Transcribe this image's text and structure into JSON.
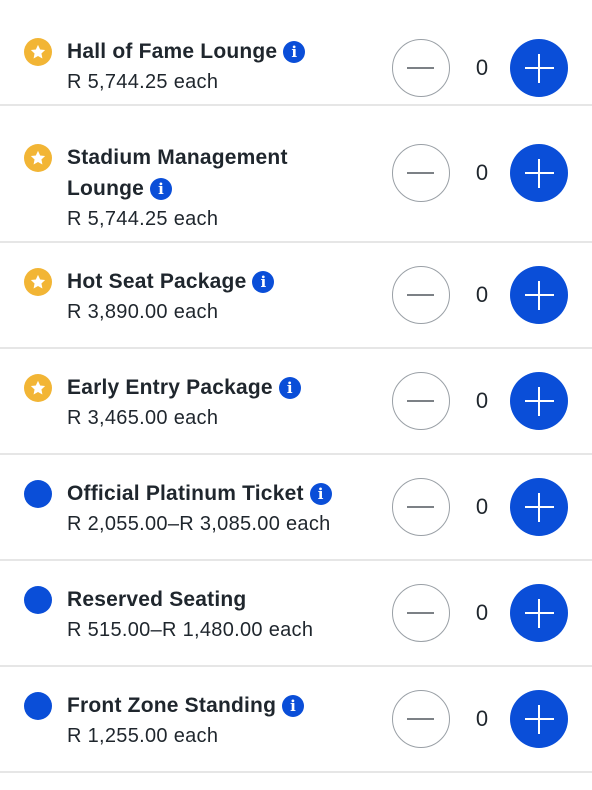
{
  "colors": {
    "accent": "#0a4ed8",
    "premium_marker": "#f2b535",
    "standard_marker": "#0a4ed8",
    "text": "#1f262d",
    "divider": "#e6e6e6"
  },
  "icons": {
    "info": "i",
    "premium_marker": "star-icon",
    "standard_marker": "dot-icon",
    "decrement": "minus-icon",
    "increment": "plus-icon"
  },
  "tickets": [
    {
      "name": "Hall of Fame Lounge",
      "name_line2": "",
      "price": "R 5,744.25 each",
      "quantity": "0",
      "tier": "premium"
    },
    {
      "name": "Stadium Management",
      "name_line2": "Lounge",
      "price": "R 5,744.25 each",
      "quantity": "0",
      "tier": "premium"
    },
    {
      "name": "Hot Seat Package",
      "name_line2": "",
      "price": "R 3,890.00 each",
      "quantity": "0",
      "tier": "premium"
    },
    {
      "name": "Early Entry Package",
      "name_line2": "",
      "price": "R 3,465.00 each",
      "quantity": "0",
      "tier": "premium"
    },
    {
      "name": "Official Platinum Ticket",
      "name_line2": "",
      "price": "R 2,055.00–R 3,085.00 each",
      "quantity": "0",
      "tier": "standard"
    },
    {
      "name": "Reserved Seating",
      "name_line2": "",
      "price": "R 515.00–R 1,480.00 each",
      "quantity": "0",
      "tier": "standard",
      "has_info": false
    },
    {
      "name": "Front Zone Standing",
      "name_line2": "",
      "price": "R 1,255.00 each",
      "quantity": "0",
      "tier": "standard"
    }
  ]
}
